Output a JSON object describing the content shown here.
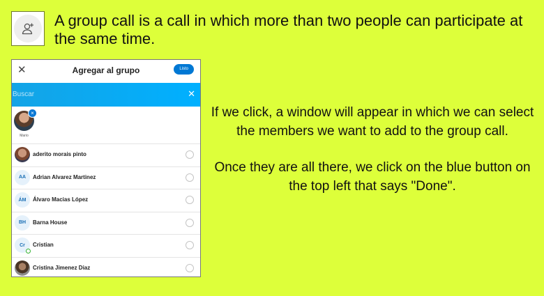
{
  "intro": {
    "text": "A group call is a call in which more than two people can participate at the same time."
  },
  "dialog": {
    "title": "Agregar al grupo",
    "done_label": "Listo",
    "search_placeholder": "Buscar",
    "selected": {
      "name": "Mario"
    },
    "contacts": [
      {
        "name": "aderito morais pinto",
        "initials": ""
      },
      {
        "name": "Adrian Alvarez Martinez",
        "initials": "AA"
      },
      {
        "name": "Álvaro Macias López",
        "initials": "ÁM"
      },
      {
        "name": "Barna House",
        "initials": "BH"
      },
      {
        "name": "Cristian",
        "initials": "Cr"
      },
      {
        "name": "Cristina Jimenez Diaz",
        "initials": ""
      }
    ]
  },
  "explanation": {
    "paragraph1": "If we click, a window will appear in which we can select the members we want to add to the group call.",
    "paragraph2": "Once they are all there, we click on the blue button on the top left that says \"Done\"."
  },
  "colors": {
    "background": "#ddff3a",
    "accent": "#0078d4",
    "search_bar": "#00b0ff",
    "online": "#34b233"
  },
  "icons": {
    "add_person": "add-person-icon",
    "close": "close-icon",
    "clear_search": "clear-search-icon",
    "remove_selected": "remove-selected-icon"
  }
}
